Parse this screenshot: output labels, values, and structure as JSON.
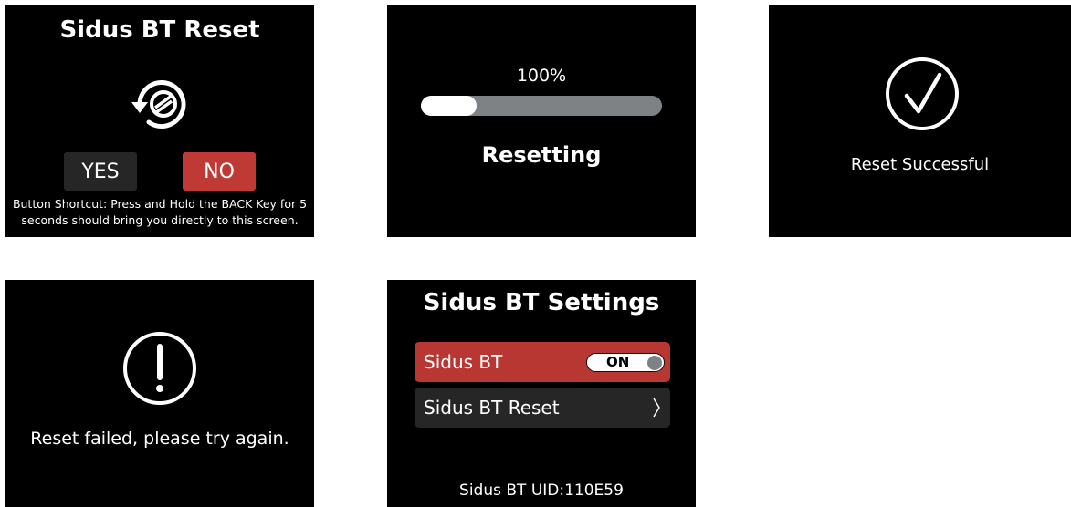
{
  "reset_screen": {
    "title": "Sidus BT Reset",
    "icon": "reset-icon",
    "yes_label": "YES",
    "no_label": "NO",
    "hint_line1": "Button Shortcut: Press and Hold the BACK Key for 5",
    "hint_line2": "seconds should bring you directly to this screen.",
    "colors": {
      "yes_bg": "#262626",
      "no_bg": "#c03a35"
    }
  },
  "resetting_screen": {
    "percent_text": "100%",
    "progress_fill_fraction": 0.23,
    "status_label": "Resetting",
    "colors": {
      "bar_track": "#7f8284",
      "bar_fill": "#ffffff"
    }
  },
  "success_screen": {
    "icon": "check-circle-icon",
    "message": "Reset Successful"
  },
  "failed_screen": {
    "icon": "exclamation-circle-icon",
    "message": "Reset failed, please try again."
  },
  "settings_screen": {
    "title": "Sidus BT Settings",
    "bt_row_label": "Sidus BT",
    "bt_toggle_text": "ON",
    "reset_row_label": "Sidus BT Reset",
    "chevron_icon": "chevron-right-icon",
    "uid_text": "Sidus BT UID:110E59",
    "colors": {
      "active_row": "#b93732",
      "row": "#262626"
    }
  }
}
